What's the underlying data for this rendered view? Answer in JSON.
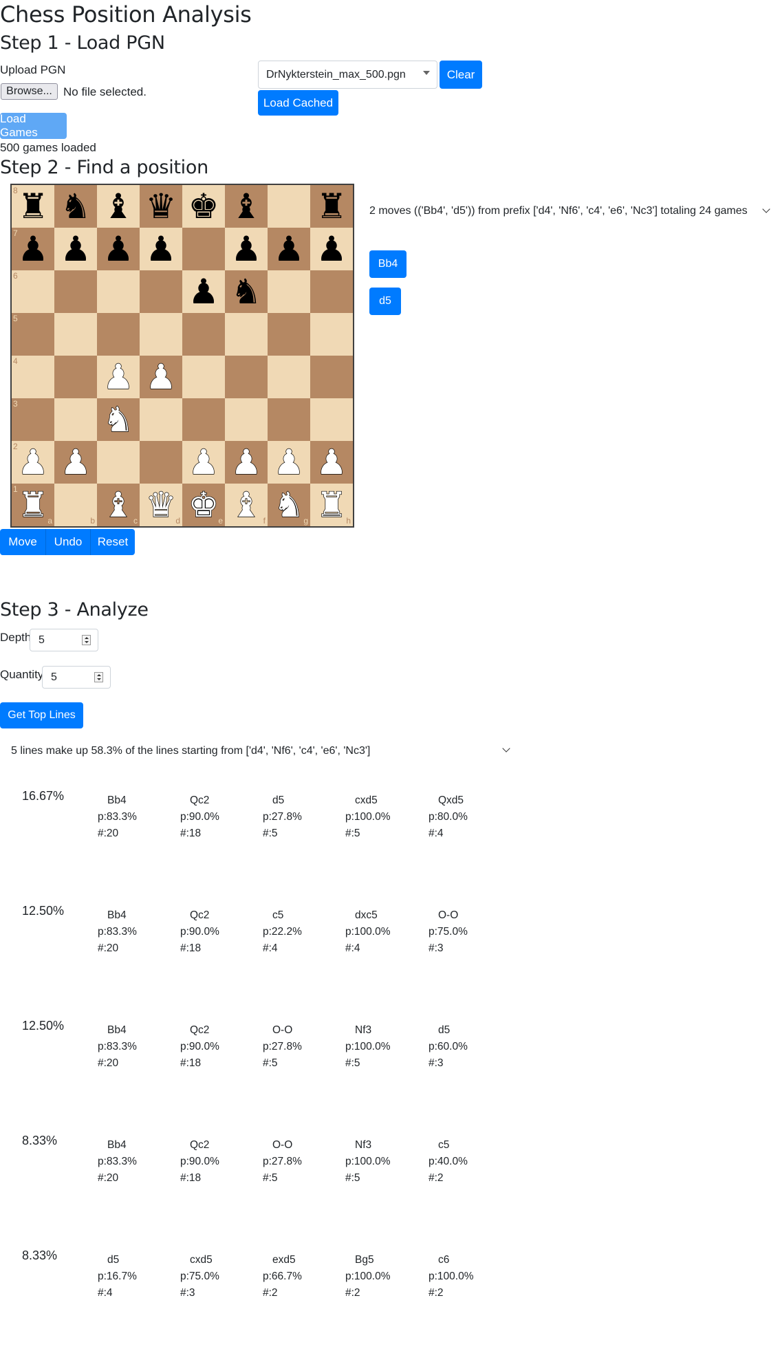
{
  "title": "Chess Position Analysis",
  "step1": {
    "heading": "Step 1 - Load PGN",
    "upload_label": "Upload PGN",
    "browse_label": "Browse...",
    "file_status": "No file selected.",
    "selected_file": "DrNykterstein_max_500.pgn",
    "clear_label": "Clear",
    "load_cached_label": "Load Cached",
    "load_games_label": "Load Games",
    "games_loaded": "500 games loaded"
  },
  "step2": {
    "heading": "Step 2 - Find a position",
    "board": [
      [
        "r",
        "n",
        "b",
        "q",
        "k",
        "b",
        "",
        "r"
      ],
      [
        "p",
        "p",
        "p",
        "p",
        "",
        "p",
        "p",
        "p"
      ],
      [
        "",
        "",
        "",
        "",
        "p",
        "n",
        "",
        ""
      ],
      [
        "",
        "",
        "",
        "",
        "",
        "",
        "",
        ""
      ],
      [
        "",
        "",
        "P",
        "P",
        "",
        "",
        "",
        ""
      ],
      [
        "",
        "",
        "N",
        "",
        "",
        "",
        "",
        ""
      ],
      [
        "P",
        "P",
        "",
        "",
        "P",
        "P",
        "P",
        "P"
      ],
      [
        "R",
        "",
        "B",
        "Q",
        "K",
        "B",
        "N",
        "R"
      ]
    ],
    "ranks": [
      "8",
      "7",
      "6",
      "5",
      "4",
      "3",
      "2",
      "1"
    ],
    "files": [
      "a",
      "b",
      "c",
      "d",
      "e",
      "f",
      "g",
      "h"
    ],
    "move_label": "Move",
    "undo_label": "Undo",
    "reset_label": "Reset",
    "moves_summary": "2 moves (('Bb4', 'd5')) from prefix ['d4', 'Nf6', 'c4', 'e6', 'Nc3'] totaling 24 games",
    "next_moves": [
      "Bb4",
      "d5"
    ]
  },
  "step3": {
    "heading": "Step 3 - Analyze",
    "depth_label": "Depth",
    "depth_value": "5",
    "quantity_label": "Quantity",
    "quantity_value": "5",
    "top_lines_label": "Get Top Lines",
    "lines_summary": "5 lines make up 58.3% of the lines starting from ['d4', 'Nf6', 'c4', 'e6', 'Nc3']",
    "lines": [
      {
        "pct": "16.67%",
        "moves": [
          {
            "san": "Bb4",
            "p": "p:83.3%",
            "n": "#:20"
          },
          {
            "san": "Qc2",
            "p": "p:90.0%",
            "n": "#:18"
          },
          {
            "san": "d5",
            "p": "p:27.8%",
            "n": "#:5"
          },
          {
            "san": "cxd5",
            "p": "p:100.0%",
            "n": "#:5"
          },
          {
            "san": "Qxd5",
            "p": "p:80.0%",
            "n": "#:4"
          }
        ]
      },
      {
        "pct": "12.50%",
        "moves": [
          {
            "san": "Bb4",
            "p": "p:83.3%",
            "n": "#:20"
          },
          {
            "san": "Qc2",
            "p": "p:90.0%",
            "n": "#:18"
          },
          {
            "san": "c5",
            "p": "p:22.2%",
            "n": "#:4"
          },
          {
            "san": "dxc5",
            "p": "p:100.0%",
            "n": "#:4"
          },
          {
            "san": "O-O",
            "p": "p:75.0%",
            "n": "#:3"
          }
        ]
      },
      {
        "pct": "12.50%",
        "moves": [
          {
            "san": "Bb4",
            "p": "p:83.3%",
            "n": "#:20"
          },
          {
            "san": "Qc2",
            "p": "p:90.0%",
            "n": "#:18"
          },
          {
            "san": "O-O",
            "p": "p:27.8%",
            "n": "#:5"
          },
          {
            "san": "Nf3",
            "p": "p:100.0%",
            "n": "#:5"
          },
          {
            "san": "d5",
            "p": "p:60.0%",
            "n": "#:3"
          }
        ]
      },
      {
        "pct": "8.33%",
        "moves": [
          {
            "san": "Bb4",
            "p": "p:83.3%",
            "n": "#:20"
          },
          {
            "san": "Qc2",
            "p": "p:90.0%",
            "n": "#:18"
          },
          {
            "san": "O-O",
            "p": "p:27.8%",
            "n": "#:5"
          },
          {
            "san": "Nf3",
            "p": "p:100.0%",
            "n": "#:5"
          },
          {
            "san": "c5",
            "p": "p:40.0%",
            "n": "#:2"
          }
        ]
      },
      {
        "pct": "8.33%",
        "moves": [
          {
            "san": "d5",
            "p": "p:16.7%",
            "n": "#:4"
          },
          {
            "san": "cxd5",
            "p": "p:75.0%",
            "n": "#:3"
          },
          {
            "san": "exd5",
            "p": "p:66.7%",
            "n": "#:2"
          },
          {
            "san": "Bg5",
            "p": "p:100.0%",
            "n": "#:2"
          },
          {
            "san": "c6",
            "p": "p:100.0%",
            "n": "#:2"
          }
        ]
      }
    ]
  }
}
